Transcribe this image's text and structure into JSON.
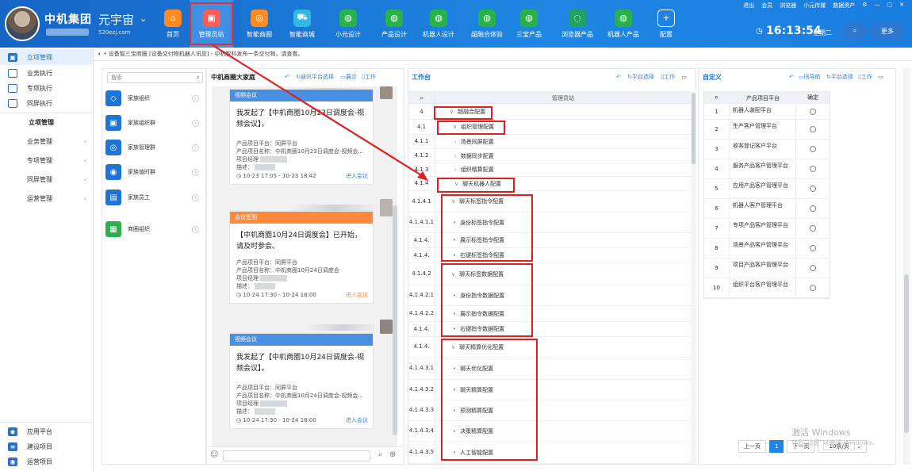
{
  "company": {
    "name": "中机集团",
    "brand": "元宇宙",
    "brand_url": "520ezj.com"
  },
  "nav": [
    {
      "label": "首页",
      "icon": "home-icon",
      "color": "#ff8a1f"
    },
    {
      "label": "管理员站",
      "icon": "admin-icon",
      "color": "#ff5a5a"
    },
    {
      "label": "智能商圈",
      "icon": "circle-icon",
      "color": "#ff8a1f"
    },
    {
      "label": "智能商城",
      "icon": "cart-icon",
      "color": "#30b9e6"
    },
    {
      "label": "小元设计",
      "icon": "globe-icon",
      "color": "#28b24a"
    },
    {
      "label": "产品设计",
      "icon": "globe-icon",
      "color": "#28b24a"
    },
    {
      "label": "机器人设计",
      "icon": "globe-icon",
      "color": "#28b24a"
    },
    {
      "label": "超融合体验",
      "icon": "globe-icon",
      "color": "#28b24a"
    },
    {
      "label": "三宝产品",
      "icon": "globe-icon",
      "color": "#28b24a"
    },
    {
      "label": "浏览器产品",
      "icon": "browser-icon",
      "color": "#1ea362"
    },
    {
      "label": "机器人产品",
      "icon": "globe-icon",
      "color": "#28b24a"
    },
    {
      "label": "配置",
      "icon": "plus-icon",
      "color": "#4a90e2"
    }
  ],
  "toplinks": [
    "退出",
    "会员",
    "浏览器",
    "小元传媒",
    "数据资产"
  ],
  "clock": "16:13:54",
  "weekday": "星期二",
  "more_label": "更多",
  "notice": "• 设备智三宝商圈 [设备交付物机器人讯息] - 中机智科发布一条交付物，请查看。",
  "sidebar": {
    "items": [
      {
        "label": "立项管理",
        "selected": true
      },
      {
        "label": "业务执行"
      },
      {
        "label": "专项执行"
      },
      {
        "label": "同屏执行"
      }
    ],
    "section_title": "立项管理",
    "subs": [
      "业务管理",
      "专项管理",
      "同屏管理",
      "运营管理"
    ],
    "bottom": [
      "应用平台",
      "建设项目",
      "运营项目"
    ]
  },
  "orgpanel": {
    "search_placeholder": "搜索",
    "orgs": [
      "家族组织",
      "家族组织群",
      "家族管理群",
      "家族值时群",
      "家族员工",
      "商圈组织"
    ]
  },
  "chat": {
    "title": "中机商圈大家庭",
    "tools": [
      "通讯平台选择",
      "展示",
      "工作"
    ],
    "cards": [
      {
        "header": "视频会议",
        "color": "#4a90e2",
        "title": "我发起了【中机商圈10月23日调度会-视频会议】。",
        "platform": "产品项目平台：同屏平台",
        "name": "产品项目名称：中机商圈10月23日调度会-视频会...",
        "manager": "项目经理",
        "desc": "描述：",
        "time": "10-23 17:05 - 10-23 18:42",
        "action": "进入会议",
        "action_color": "#3b7dd8"
      },
      {
        "header": "会议签到",
        "color": "#ff8a3d",
        "title": "【中机商圈10月24日调度会】已开始，请及时参会。",
        "platform": "产品项目平台：同屏平台",
        "name": "产品项目名称：中机商圈10月24日调度会",
        "manager": "项目经理",
        "desc": "描述：",
        "time": "10-24 17:30 - 10-24 18:00",
        "action": "进入会议",
        "action_color": "#ff8a3d"
      },
      {
        "header": "视频会议",
        "color": "#4a90e2",
        "title": "我发起了【中机商圈10月24日调度会-视频会议】。",
        "platform": "产品项目平台：同屏平台",
        "name": "产品项目名称：中机商圈10月24日调度会-视频会...",
        "manager": "项目经理",
        "desc": "描述：",
        "time": "10-24 17:30 - 10-24 18:00",
        "action": "进入会议",
        "action_color": "#3b7dd8"
      }
    ]
  },
  "work": {
    "title": "工作台",
    "tools": [
      "平台选择",
      "工作"
    ],
    "header": "管理员站",
    "rows": [
      {
        "num": "4",
        "name": "超融合配置",
        "level": 0,
        "caret": "∨"
      },
      {
        "num": "4.1",
        "name": "组织管理配置",
        "level": 1,
        "caret": "∨"
      },
      {
        "num": "4.1.1",
        "name": "场景同屏配置",
        "level": 2,
        "caret": "›"
      },
      {
        "num": "4.1.2",
        "name": "数据同步配置",
        "level": 2,
        "caret": "›"
      },
      {
        "num": "4.1.3",
        "name": "组织精算配置",
        "level": 2,
        "caret": "›"
      },
      {
        "num": "4.1.4",
        "name": "聊天机器人配置",
        "level": 2,
        "caret": "∨"
      },
      {
        "num": "4.1.4.1",
        "name": "聊天标签指令配置",
        "level": 3,
        "caret": "∨"
      },
      {
        "num": "4.1.4.1.1",
        "name": "身份标签指令配置",
        "level": 4,
        "caret": "•"
      },
      {
        "num": "4.1.4.",
        "name": "展示标签指令配置",
        "level": 4,
        "caret": "•"
      },
      {
        "num": "4.1.4.",
        "name": "右键标签指令配置",
        "level": 4,
        "caret": "•"
      },
      {
        "num": "4.1.4.2",
        "name": "聊天标签数据配置",
        "level": 3,
        "caret": "∨"
      },
      {
        "num": "4.1.4.2.1",
        "name": "身份指令数据配置",
        "level": 4,
        "caret": "•"
      },
      {
        "num": "4.1.4.2.2",
        "name": "展示指令数据配置",
        "level": 4,
        "caret": "•"
      },
      {
        "num": "4.1.4.",
        "name": "右键指令数据配置",
        "level": 4,
        "caret": "•"
      },
      {
        "num": "4.1.4.",
        "name": "聊天精算优化配置",
        "level": 3,
        "caret": "∨"
      },
      {
        "num": "4.1.4.3.1",
        "name": "聊天优化配置",
        "level": 4,
        "caret": "•"
      },
      {
        "num": "4.1.4.3.2",
        "name": "聊天精算配置",
        "level": 4,
        "caret": "•"
      },
      {
        "num": "4.1.4.3.3",
        "name": "预测精算配置",
        "level": 4,
        "caret": "•"
      },
      {
        "num": "4.1.4.3.4",
        "name": "决策精算配置",
        "level": 4,
        "caret": "•"
      },
      {
        "num": "4.1.4.3.5",
        "name": "人工智能配置",
        "level": 4,
        "caret": "•"
      }
    ]
  },
  "custom": {
    "title": "自定义",
    "tools": [
      "同导航",
      "平台选择",
      "工作"
    ],
    "header_col": "产品项目平台",
    "confirm_col": "确定",
    "rows": [
      {
        "num": "1",
        "name": "机器人装配平台"
      },
      {
        "num": "2",
        "name": "生产客户管理平台"
      },
      {
        "num": "3",
        "name": "收客登记客户平台"
      },
      {
        "num": "4",
        "name": "服务产品客户管理平台"
      },
      {
        "num": "5",
        "name": "应用产品客户管理平台"
      },
      {
        "num": "6",
        "name": "机器人客户管理平台"
      },
      {
        "num": "7",
        "name": "专项产品客户管理平台"
      },
      {
        "num": "8",
        "name": "场景产品客户管理平台"
      },
      {
        "num": "9",
        "name": "项目产品客户管理平台"
      },
      {
        "num": "10",
        "name": "组织平台客户管理平台"
      }
    ],
    "pager": {
      "prev": "上一页",
      "current": "1",
      "next": "下一页",
      "size": "10条/页"
    }
  },
  "watermark": {
    "line1": "激活 Windows",
    "line2": "转到\"设置\"以激活 Windows。"
  }
}
